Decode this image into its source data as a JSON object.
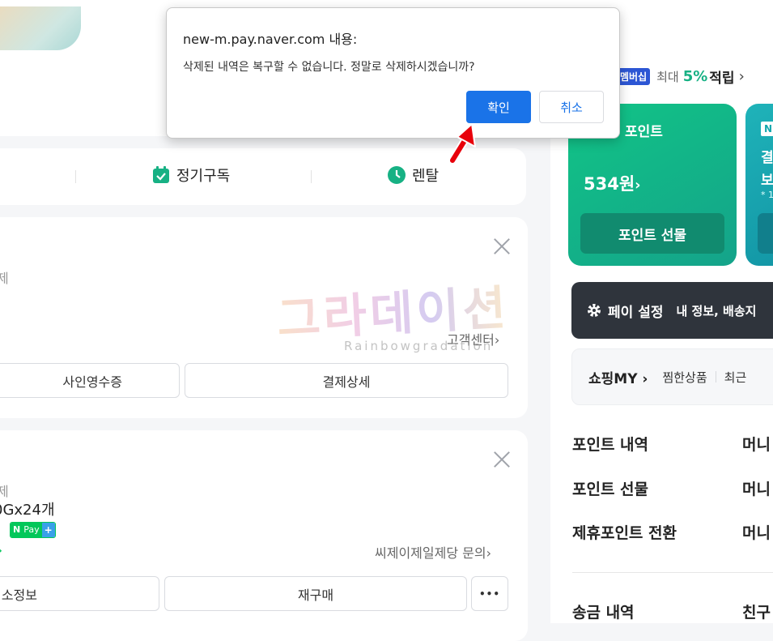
{
  "dialog": {
    "title": "new-m.pay.naver.com 내용:",
    "message": "삭제된 내역은 복구할 수 없습니다. 정말로 삭제하시겠습니까?",
    "ok_label": "확인",
    "cancel_label": "취소"
  },
  "tabs": {
    "subscription": "정기구독",
    "rental": "렌탈"
  },
  "order1": {
    "status": "제",
    "customer_center": "고객센터",
    "receipt_button": "사인영수증",
    "detail_button": "결제상세"
  },
  "order2": {
    "status": "제",
    "product": "0Gx24개",
    "seller_inquiry": "씨제이제일제당 문의",
    "pay_badge": "Pay",
    "info_button": "소정보",
    "reorder_button": "재구매",
    "more_glyph": "•••"
  },
  "membership": {
    "badge": "멤버십",
    "prefix": "최대",
    "percent": "5%",
    "suffix": "적립"
  },
  "point_card": {
    "title": "포인트",
    "amount": "534원",
    "gift_button": "포인트 선물"
  },
  "side_card": {
    "line1": "결",
    "line2": "보",
    "note": "* 1"
  },
  "pay_settings": {
    "label": "페이 설정",
    "sub": "내 정보, 배송지"
  },
  "shopping": {
    "label": "쇼핑MY",
    "wish": "찜한상품",
    "recent": "최근"
  },
  "menu": {
    "point_history": "포인트 내역",
    "point_gift": "포인트 선물",
    "partner_point": "제휴포인트 전환",
    "money1": "머니",
    "money2": "머니",
    "money3": "머니",
    "transfer_history": "송금 내역",
    "friend": "친구"
  },
  "watermark": {
    "main": "그라데이션",
    "sub": "Rainbowgradation"
  },
  "colors": {
    "accent_blue": "#1a73e8",
    "naver_green": "#03c75a",
    "point_teal": "#17b184"
  }
}
